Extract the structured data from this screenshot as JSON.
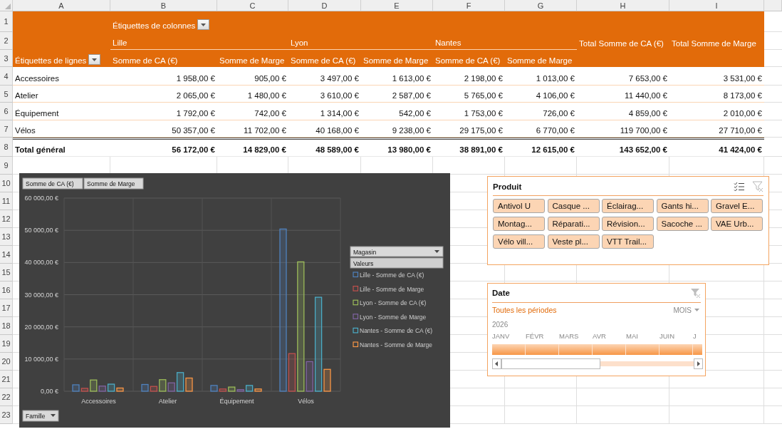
{
  "sheet": {
    "columns": [
      "A",
      "B",
      "C",
      "D",
      "E",
      "F",
      "G",
      "H",
      "I"
    ],
    "row_numbers": [
      "1",
      "2",
      "3",
      "4",
      "5",
      "6",
      "7",
      "8",
      "9",
      "10",
      "11",
      "12",
      "13",
      "14",
      "15",
      "16",
      "17",
      "18",
      "19",
      "20",
      "21",
      "22",
      "23"
    ]
  },
  "pivot": {
    "column_labels_header": "Étiquettes de colonnes",
    "row_labels_header": "Étiquettes de lignes",
    "stores": [
      "Lille",
      "Lyon",
      "Nantes"
    ],
    "measures": [
      "Somme de CA (€)",
      "Somme de Marge",
      "Somme de CA (€)",
      "Somme de Marge",
      "Somme de CA (€)",
      "Somme de Marge"
    ],
    "grand_totals": [
      "Total Somme de CA (€)",
      "Total Somme de Marge"
    ],
    "rows": [
      {
        "label": "Accessoires",
        "values": [
          "1 958,00 €",
          "905,00 €",
          "3 497,00 €",
          "1 613,00 €",
          "2 198,00 €",
          "1 013,00 €",
          "7 653,00 €",
          "3 531,00 €"
        ]
      },
      {
        "label": "Atelier",
        "values": [
          "2 065,00 €",
          "1 480,00 €",
          "3 610,00 €",
          "2 587,00 €",
          "5 765,00 €",
          "4 106,00 €",
          "11 440,00 €",
          "8 173,00 €"
        ]
      },
      {
        "label": "Équipement",
        "values": [
          "1 792,00 €",
          "742,00 €",
          "1 314,00 €",
          "542,00 €",
          "1 753,00 €",
          "726,00 €",
          "4 859,00 €",
          "2 010,00 €"
        ]
      },
      {
        "label": "Vélos",
        "values": [
          "50 357,00 €",
          "11 702,00 €",
          "40 168,00 €",
          "9 238,00 €",
          "29 175,00 €",
          "6 770,00 €",
          "119 700,00 €",
          "27 710,00 €"
        ]
      }
    ],
    "total": {
      "label": "Total général",
      "values": [
        "56 172,00 €",
        "14 829,00 €",
        "48 589,00 €",
        "13 980,00 €",
        "38 891,00 €",
        "12 615,00 €",
        "143 652,00 €",
        "41 424,00 €"
      ]
    }
  },
  "chart": {
    "value_buttons": [
      "Somme de CA (€)",
      "Somme de Marge"
    ],
    "axis_button": "Famille",
    "legend_button": "Magasin",
    "legend_values_header": "Valeurs",
    "chart_data": {
      "type": "bar",
      "categories": [
        "Accessoires",
        "Atelier",
        "Équipement",
        "Vélos"
      ],
      "series": [
        {
          "name": "Lille - Somme de CA (€)",
          "color": "#4f81bd",
          "values": [
            2000,
            2100,
            1800,
            50400
          ]
        },
        {
          "name": "Lille - Somme de Marge",
          "color": "#c0504d",
          "values": [
            900,
            1500,
            700,
            11700
          ]
        },
        {
          "name": "Lyon - Somme de CA (€)",
          "color": "#9bbb59",
          "values": [
            3500,
            3600,
            1300,
            40200
          ]
        },
        {
          "name": "Lyon - Somme de Marge",
          "color": "#8064a2",
          "values": [
            1600,
            2600,
            500,
            9200
          ]
        },
        {
          "name": "Nantes - Somme de CA (€)",
          "color": "#4bacc6",
          "values": [
            2200,
            5800,
            1800,
            29200
          ]
        },
        {
          "name": "Nantes - Somme de Marge",
          "color": "#f79646",
          "values": [
            1000,
            4100,
            700,
            6800
          ]
        }
      ],
      "grid": true,
      "legend": true,
      "ylim": [
        0,
        60000
      ],
      "yticks": [
        {
          "value": 0,
          "label": "0,00 €"
        },
        {
          "value": 10000,
          "label": "10 000,00 €"
        },
        {
          "value": 20000,
          "label": "20 000,00 €"
        },
        {
          "value": 30000,
          "label": "30 000,00 €"
        },
        {
          "value": 40000,
          "label": "40 000,00 €"
        },
        {
          "value": 50000,
          "label": "50 000,00 €"
        },
        {
          "value": 60000,
          "label": "60 000,00 €"
        }
      ]
    }
  },
  "product_slicer": {
    "title": "Produit",
    "clear_filter_enabled": false,
    "items": [
      {
        "label": "Antivol U",
        "selected": true
      },
      {
        "label": "Casque ...",
        "selected": true
      },
      {
        "label": "Éclairag...",
        "selected": true
      },
      {
        "label": "Gants hi...",
        "selected": true
      },
      {
        "label": "Gravel E...",
        "selected": true
      },
      {
        "label": "Montag...",
        "selected": true
      },
      {
        "label": "Réparati...",
        "selected": true
      },
      {
        "label": "Révision...",
        "selected": true
      },
      {
        "label": "Sacoche ...",
        "selected": true
      },
      {
        "label": "VAE Urb...",
        "selected": true
      },
      {
        "label": "Vélo vill...",
        "selected": true
      },
      {
        "label": "Veste pl...",
        "selected": true
      },
      {
        "label": "VTT Trail...",
        "selected": true
      }
    ]
  },
  "date_timeline": {
    "title": "Date",
    "clear_filter_enabled": false,
    "selection_label": "Toutes les périodes",
    "period_unit": "MOIS",
    "year": "2026",
    "months": [
      {
        "label": "JANV",
        "selected": true
      },
      {
        "label": "FÉVR",
        "selected": true
      },
      {
        "label": "MARS",
        "selected": true
      },
      {
        "label": "AVR",
        "selected": true
      },
      {
        "label": "MAI",
        "selected": true
      },
      {
        "label": "JUIN",
        "selected": true
      },
      {
        "label": "J",
        "selected": true
      }
    ]
  }
}
